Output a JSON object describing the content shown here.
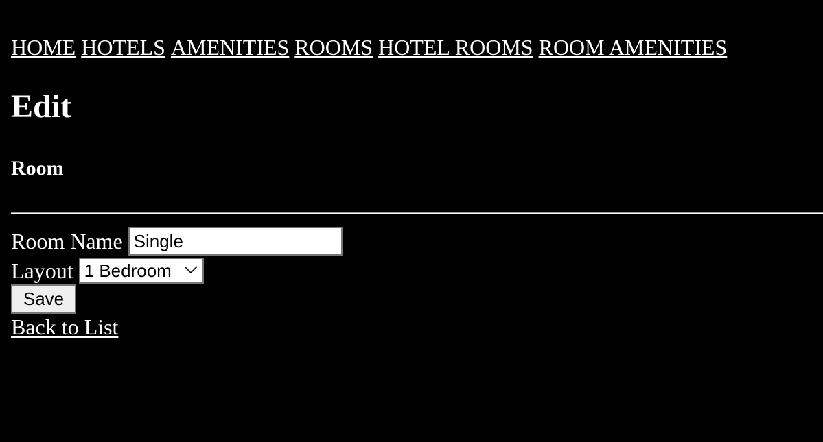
{
  "nav": {
    "items": [
      {
        "label": "HOME"
      },
      {
        "label": "HOTELS"
      },
      {
        "label": "AMENITIES"
      },
      {
        "label": "ROOMS"
      },
      {
        "label": "HOTEL ROOMS"
      },
      {
        "label": "ROOM AMENITIES"
      }
    ]
  },
  "page": {
    "title": "Edit",
    "subtitle": "Room"
  },
  "form": {
    "room_name_label": "Room Name",
    "room_name_value": "Single",
    "layout_label": "Layout",
    "layout_selected": "1 Bedroom",
    "save_label": "Save"
  },
  "footer": {
    "back_label": "Back to List"
  },
  "colors": {
    "background": "#000000",
    "text": "#ffffff",
    "input_border": "#767676",
    "button_bg": "#efefef"
  },
  "icons": {
    "select_arrow": "chevron-down-icon"
  }
}
